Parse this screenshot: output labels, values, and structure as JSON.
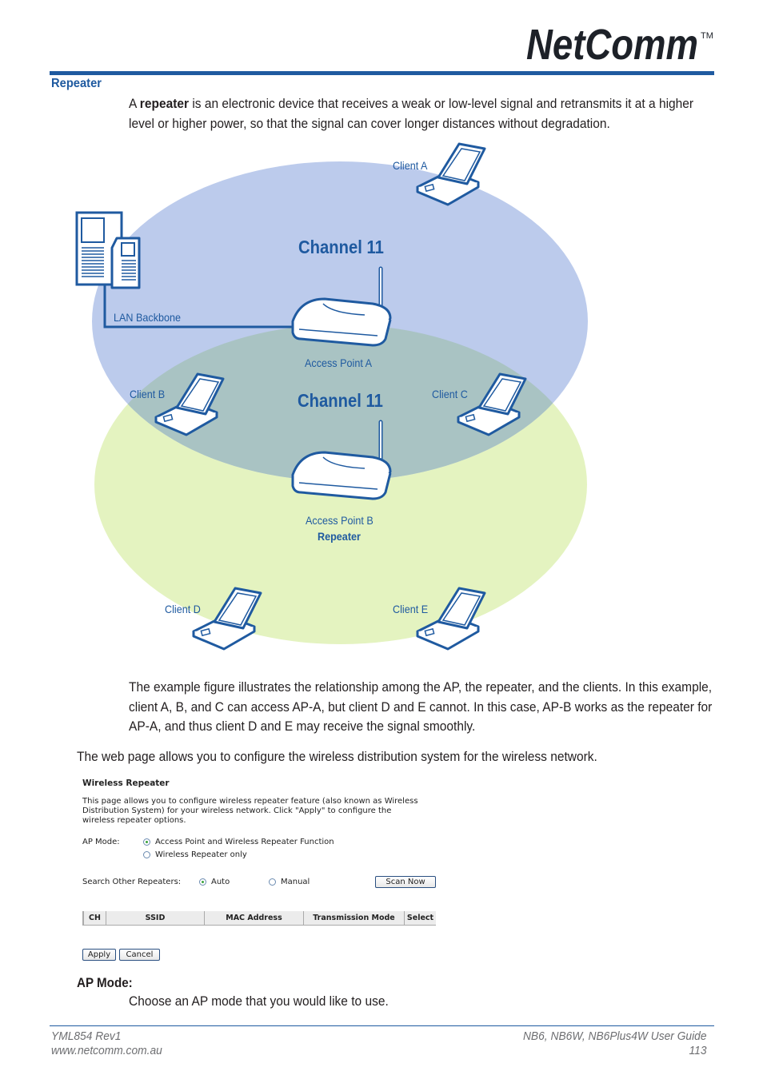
{
  "header": {
    "logo_text": "NetComm",
    "trademark": "TM",
    "brand_color": "#1f5aa0"
  },
  "section": {
    "title": "Repeater",
    "intro_prefix": "A ",
    "intro_bold": "repeater",
    "intro_rest": " is an electronic device that receives a weak or low-level signal and retransmits it at a higher level or higher power, so that the signal can cover longer distances without degradation."
  },
  "diagram": {
    "colors": {
      "zone_a": "#bccbec",
      "zone_b": "#e4f3c0",
      "overlap": "#a9c3c3",
      "line": "#1f5aa0"
    },
    "channel_a": "Channel 11",
    "channel_b": "Channel 11",
    "lan_backbone": "LAN Backbone",
    "access_point_a": "Access Point A",
    "access_point_b": "Access Point B",
    "access_point_b_role": "Repeater",
    "clients": [
      "Client A",
      "Client B",
      "Client C",
      "Client D",
      "Client E"
    ]
  },
  "body": {
    "paragraph1": "The example figure illustrates the relationship among the AP, the repeater, and the clients. In this example, client A, B, and C can access AP-A, but client D and E cannot. In this case, AP-B works as the repeater for AP-A, and thus client D and E may receive the signal smoothly.",
    "paragraph2": "The web page allows you to configure the wireless distribution system for the wireless network."
  },
  "webform": {
    "title": "Wireless Repeater",
    "description": "This page allows you to configure wireless repeater feature (also known as Wireless Distribution System) for your wireless network. Click \"Apply\" to configure the wireless repeater options.",
    "ap_mode_label": "AP Mode:",
    "ap_mode_options": [
      {
        "label": "Access Point and Wireless Repeater Function",
        "checked": true
      },
      {
        "label": "Wireless Repeater only",
        "checked": false
      }
    ],
    "search_label": "Search Other Repeaters:",
    "search_options": [
      {
        "label": "Auto",
        "checked": true
      },
      {
        "label": "Manual",
        "checked": false
      }
    ],
    "scan_button": "Scan Now",
    "table_headers": [
      "CH",
      "SSID",
      "MAC Address",
      "Transmission Mode",
      "Select"
    ],
    "table_rows": [],
    "apply_button": "Apply",
    "cancel_button": "Cancel"
  },
  "ap_mode_section": {
    "heading": "AP Mode:",
    "description": "Choose an AP mode that you would like to use."
  },
  "footer": {
    "doc_code": "YML854 Rev1",
    "website": "www.netcomm.com.au",
    "guide_title": "NB6, NB6W, NB6Plus4W User Guide",
    "page_number": "113"
  }
}
